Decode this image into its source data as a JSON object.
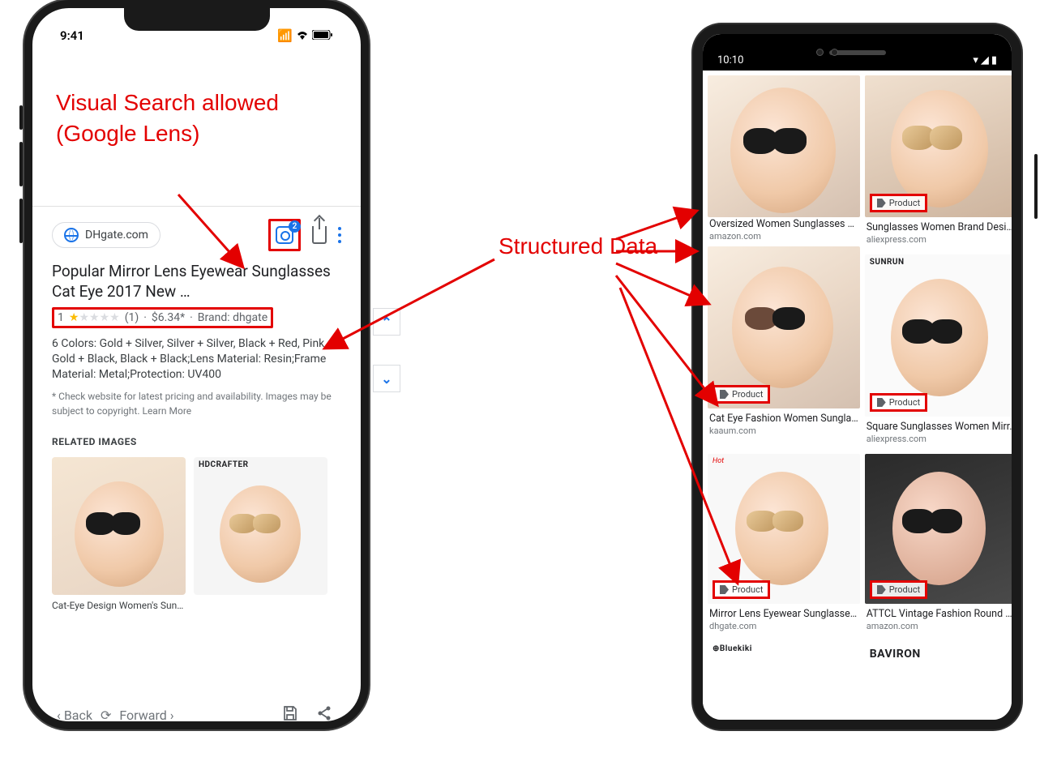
{
  "annotations": {
    "lens_label": "Visual Search allowed (Google Lens)",
    "structured_data": "Structured Data"
  },
  "iphone": {
    "status": {
      "time": "9:41"
    },
    "source": {
      "domain": "DHgate.com"
    },
    "lens": {
      "badge": "2"
    },
    "product": {
      "title": "Popular Mirror Lens Eyewear Sunglasses Cat Eye 2017 New …",
      "rating_value": "1",
      "rating_count": "(1)",
      "price": "$6.34*",
      "brand_label": "Brand: dhgate",
      "description": "6 Colors: Gold + Silver, Silver + Silver, Black + Red, Pink, Gold + Black, Black + Black;Lens Material: Resin;Frame Material: Metal;Protection: UV400",
      "disclaimer": "* Check website for latest pricing and availability. Images may be subject to copyright.",
      "learn_more": "Learn More"
    },
    "related": {
      "header": "RELATED IMAGES",
      "items": [
        {
          "caption": "Cat-Eye Design Women's Sungl…",
          "brand": ""
        },
        {
          "caption": "",
          "brand": "HDCRAFTER"
        }
      ]
    },
    "bottom_nav": {
      "back": "Back",
      "forward": "Forward"
    }
  },
  "android": {
    "status": {
      "time": "10:10"
    },
    "product_badge": "Product",
    "tiles": [
      {
        "title": "Sunglasses Women Brand Desi…",
        "domain": "aliexpress.com",
        "badge": true,
        "h": "h1"
      },
      {
        "title": "",
        "domain": "",
        "badge": false,
        "h": "h1",
        "brand": ""
      },
      {
        "title": "Oversized Women Sunglasses …",
        "domain": "amazon.com",
        "badge": false,
        "h": "h2",
        "brand": ""
      },
      {
        "title": "Square Sunglasses Women Mirr…",
        "domain": "aliexpress.com",
        "badge": true,
        "h": "h2",
        "brand": "SUNRUN"
      },
      {
        "title": "Cat Eye Fashion Women Sungla…",
        "domain": "kaaum.com",
        "badge": true,
        "h": "h3"
      },
      {
        "title": "ATTCL Vintage Fashion Round …",
        "domain": "amazon.com",
        "badge": true,
        "h": "h3"
      },
      {
        "title": "Mirror Lens Eyewear Sunglasse…",
        "domain": "dhgate.com",
        "badge": true,
        "h": "h3",
        "hot": "Hot"
      },
      {
        "title": "",
        "domain": "",
        "badge": false,
        "h": "h4",
        "brand": "BAVIRON"
      },
      {
        "title": "",
        "domain": "",
        "badge": false,
        "h": "h4",
        "brand_alt": "⊕Bluekiki"
      }
    ]
  }
}
